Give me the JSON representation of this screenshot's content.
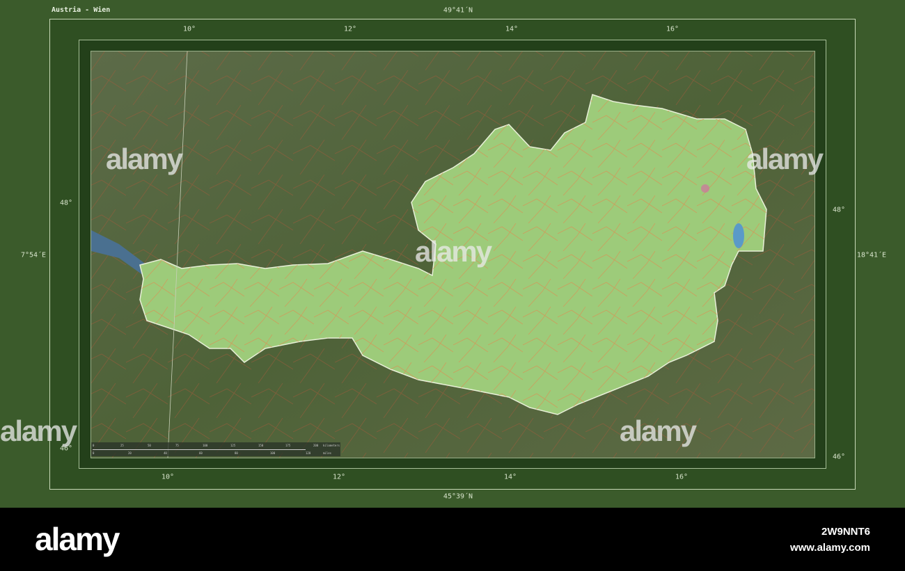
{
  "title": "Austria - Wien",
  "coordinates": {
    "top_lat": "49°41´N",
    "bottom_lat": "45°39´N",
    "left_lon": "7°54´E",
    "right_lon": "18°41´E",
    "top_ticks": [
      "10°",
      "12°",
      "14°",
      "16°"
    ],
    "bottom_ticks": [
      "10°",
      "12°",
      "14°",
      "16°"
    ],
    "left_ticks": [
      "48°",
      "46°"
    ],
    "right_ticks": [
      "48°",
      "46°"
    ]
  },
  "scale_bar": {
    "km_ticks": [
      "0",
      "25",
      "50",
      "75",
      "100",
      "125",
      "150",
      "175",
      "200"
    ],
    "km_unit": "kilometers",
    "mi_ticks": [
      "0",
      "20",
      "40",
      "60",
      "80",
      "100",
      "120"
    ],
    "mi_unit": "miles"
  },
  "colors": {
    "frame": "#3b5b2b",
    "country": "#9ccc78",
    "surroundings": "#5a6a44"
  },
  "watermark": "alamy",
  "footer": {
    "logo": "alamy",
    "image_id": "2W9NNT6",
    "website": "www.alamy.com"
  }
}
